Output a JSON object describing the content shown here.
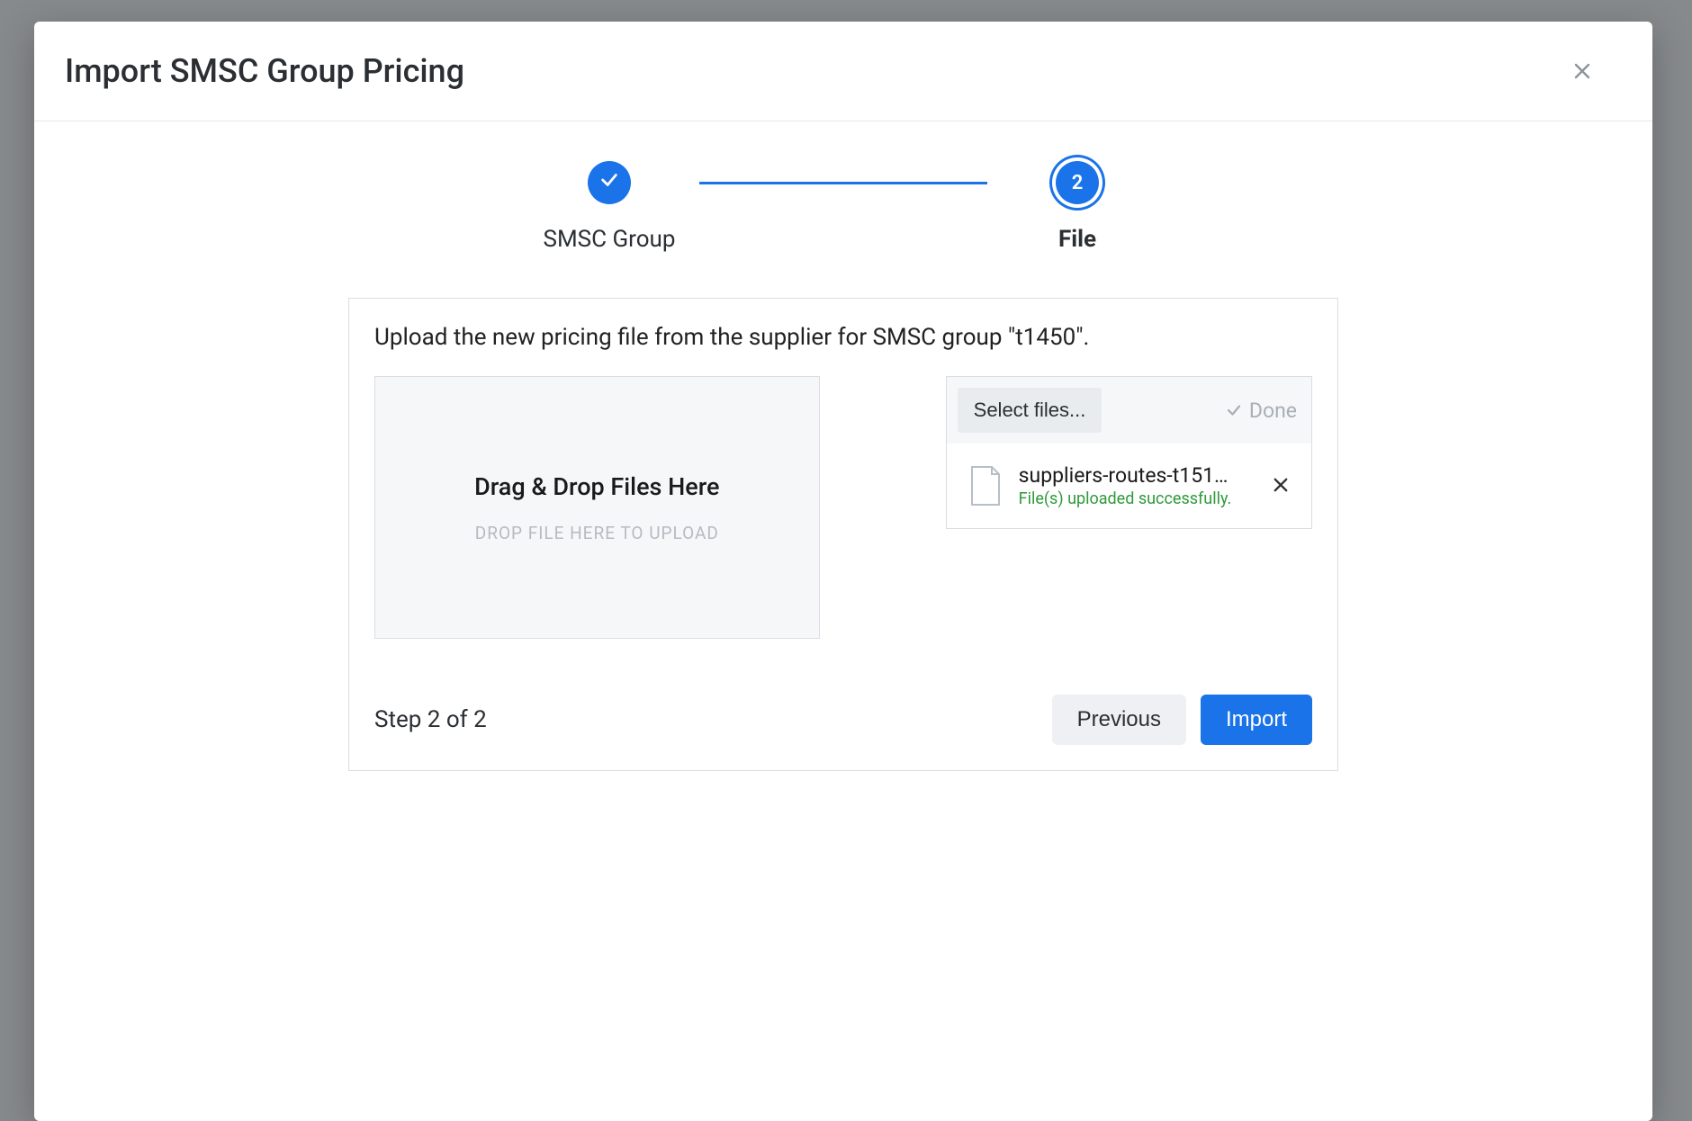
{
  "modal": {
    "title": "Import SMSC Group Pricing"
  },
  "stepper": {
    "step1": {
      "label": "SMSC Group"
    },
    "step2": {
      "number": "2",
      "label": "File"
    }
  },
  "card": {
    "instruction": "Upload the new pricing file from the supplier for SMSC group \"t1450\".",
    "dropzone": {
      "title": "Drag & Drop Files Here",
      "subtitle": "DROP FILE HERE TO UPLOAD"
    },
    "upload": {
      "select_label": "Select files...",
      "done_label": "Done",
      "file": {
        "name": "suppliers-routes-t151…",
        "status": "File(s) uploaded successfully."
      }
    },
    "footer": {
      "step_text": "Step 2 of 2",
      "previous": "Previous",
      "import": "Import"
    }
  }
}
